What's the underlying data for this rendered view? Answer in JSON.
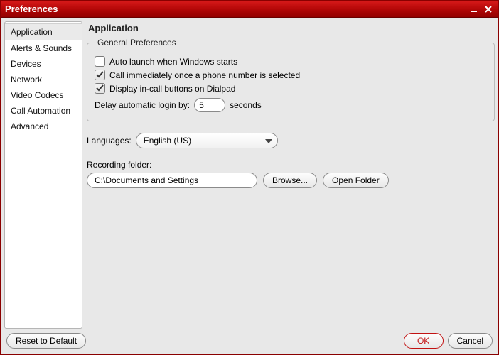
{
  "window": {
    "title": "Preferences"
  },
  "sidebar": {
    "items": [
      {
        "label": "Application"
      },
      {
        "label": "Alerts & Sounds"
      },
      {
        "label": "Devices"
      },
      {
        "label": "Network"
      },
      {
        "label": "Video Codecs"
      },
      {
        "label": "Call Automation"
      },
      {
        "label": "Advanced"
      }
    ],
    "active_index": 0
  },
  "main": {
    "heading": "Application",
    "group_title": "General Preferences",
    "checks": {
      "auto_launch": {
        "label": "Auto launch when Windows starts",
        "checked": false
      },
      "call_immediately": {
        "label": "Call immediately once a phone number is selected",
        "checked": true
      },
      "display_incall": {
        "label": "Display in-call buttons on Dialpad",
        "checked": true
      }
    },
    "delay": {
      "prefix": "Delay automatic login by:",
      "value": "5",
      "suffix": "seconds"
    },
    "languages": {
      "label": "Languages:",
      "selected": "English (US)"
    },
    "recording": {
      "label": "Recording folder:",
      "path": "C:\\Documents and Settings",
      "browse": "Browse...",
      "open": "Open Folder"
    }
  },
  "footer": {
    "reset": "Reset to Default",
    "ok": "OK",
    "cancel": "Cancel"
  }
}
